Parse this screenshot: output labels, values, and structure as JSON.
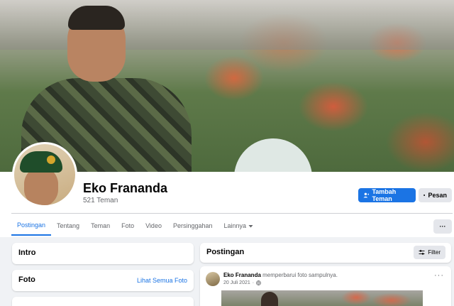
{
  "profile": {
    "name": "Eko Frananda",
    "friends": "521 Teman"
  },
  "actions": {
    "add_friend": "Tambah Teman",
    "message": "Pesan",
    "more": "···"
  },
  "tabs": [
    {
      "label": "Postingan",
      "active": true
    },
    {
      "label": "Tentang"
    },
    {
      "label": "Teman"
    },
    {
      "label": "Foto"
    },
    {
      "label": "Video"
    },
    {
      "label": "Persinggahan"
    },
    {
      "label": "Lainnya"
    }
  ],
  "intro": {
    "title": "Intro"
  },
  "photos": {
    "title": "Foto",
    "see_all": "Lihat Semua Foto"
  },
  "posts": {
    "title": "Postingan",
    "filter": "Filter",
    "items": [
      {
        "author": "Eko Frananda",
        "action": "memperbarui foto sampulnya.",
        "date": "20 Juli 2021",
        "more": "···"
      }
    ]
  },
  "colors": {
    "accent": "#1b74e4",
    "background": "#f0f2f5",
    "secondary_button": "#e4e6eb",
    "muted_text": "#65676b"
  },
  "icons": {
    "add_friend": "person-plus-icon",
    "message": "messenger-icon",
    "more_tabs": "caret-down-icon",
    "filter": "sliders-icon",
    "audience": "globe-icon"
  }
}
